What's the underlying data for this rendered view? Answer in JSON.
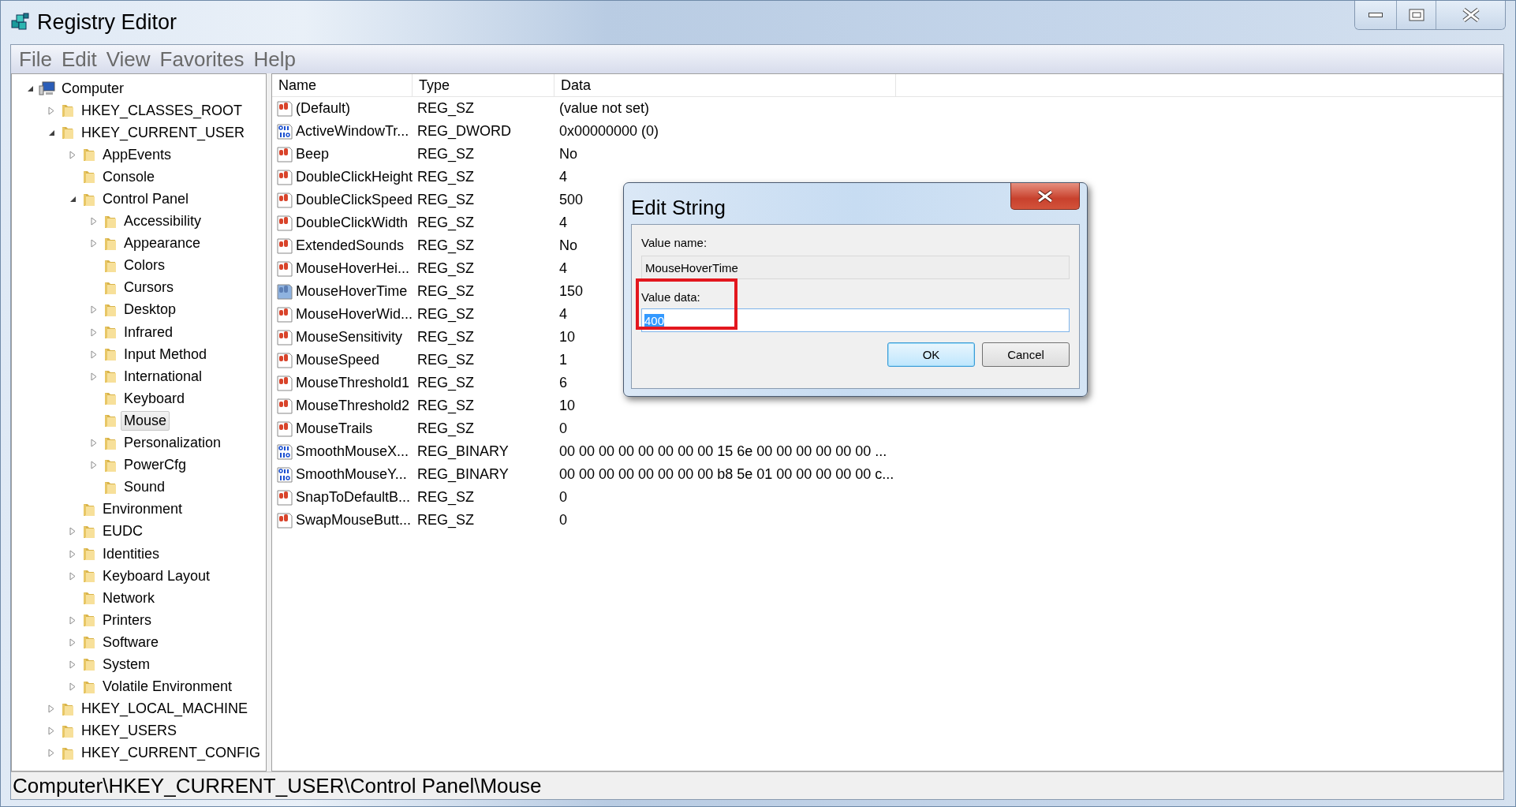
{
  "window": {
    "title": "Registry Editor"
  },
  "menu": [
    "File",
    "Edit",
    "View",
    "Favorites",
    "Help"
  ],
  "tree": [
    {
      "label": "Computer",
      "expandable": true,
      "expanded": true,
      "selected": false,
      "kind": "computer",
      "children": [
        {
          "label": "HKEY_CLASSES_ROOT",
          "expandable": true,
          "expanded": false,
          "selected": false,
          "kind": "folder"
        },
        {
          "label": "HKEY_CURRENT_USER",
          "expandable": true,
          "expanded": true,
          "selected": false,
          "kind": "folder",
          "children": [
            {
              "label": "AppEvents",
              "expandable": true,
              "expanded": false,
              "selected": false,
              "kind": "folder"
            },
            {
              "label": "Console",
              "expandable": false,
              "expanded": false,
              "selected": false,
              "kind": "folder"
            },
            {
              "label": "Control Panel",
              "expandable": true,
              "expanded": true,
              "selected": false,
              "kind": "folder",
              "children": [
                {
                  "label": "Accessibility",
                  "expandable": true,
                  "expanded": false,
                  "selected": false,
                  "kind": "folder"
                },
                {
                  "label": "Appearance",
                  "expandable": true,
                  "expanded": false,
                  "selected": false,
                  "kind": "folder"
                },
                {
                  "label": "Colors",
                  "expandable": false,
                  "expanded": false,
                  "selected": false,
                  "kind": "folder"
                },
                {
                  "label": "Cursors",
                  "expandable": false,
                  "expanded": false,
                  "selected": false,
                  "kind": "folder"
                },
                {
                  "label": "Desktop",
                  "expandable": true,
                  "expanded": false,
                  "selected": false,
                  "kind": "folder"
                },
                {
                  "label": "Infrared",
                  "expandable": true,
                  "expanded": false,
                  "selected": false,
                  "kind": "folder"
                },
                {
                  "label": "Input Method",
                  "expandable": true,
                  "expanded": false,
                  "selected": false,
                  "kind": "folder"
                },
                {
                  "label": "International",
                  "expandable": true,
                  "expanded": false,
                  "selected": false,
                  "kind": "folder"
                },
                {
                  "label": "Keyboard",
                  "expandable": false,
                  "expanded": false,
                  "selected": false,
                  "kind": "folder"
                },
                {
                  "label": "Mouse",
                  "expandable": false,
                  "expanded": false,
                  "selected": true,
                  "kind": "folder"
                },
                {
                  "label": "Personalization",
                  "expandable": true,
                  "expanded": false,
                  "selected": false,
                  "kind": "folder"
                },
                {
                  "label": "PowerCfg",
                  "expandable": true,
                  "expanded": false,
                  "selected": false,
                  "kind": "folder"
                },
                {
                  "label": "Sound",
                  "expandable": false,
                  "expanded": false,
                  "selected": false,
                  "kind": "folder"
                }
              ]
            },
            {
              "label": "Environment",
              "expandable": false,
              "expanded": false,
              "selected": false,
              "kind": "folder"
            },
            {
              "label": "EUDC",
              "expandable": true,
              "expanded": false,
              "selected": false,
              "kind": "folder"
            },
            {
              "label": "Identities",
              "expandable": true,
              "expanded": false,
              "selected": false,
              "kind": "folder"
            },
            {
              "label": "Keyboard Layout",
              "expandable": true,
              "expanded": false,
              "selected": false,
              "kind": "folder"
            },
            {
              "label": "Network",
              "expandable": false,
              "expanded": false,
              "selected": false,
              "kind": "folder"
            },
            {
              "label": "Printers",
              "expandable": true,
              "expanded": false,
              "selected": false,
              "kind": "folder"
            },
            {
              "label": "Software",
              "expandable": true,
              "expanded": false,
              "selected": false,
              "kind": "folder"
            },
            {
              "label": "System",
              "expandable": true,
              "expanded": false,
              "selected": false,
              "kind": "folder"
            },
            {
              "label": "Volatile Environment",
              "expandable": true,
              "expanded": false,
              "selected": false,
              "kind": "folder"
            }
          ]
        },
        {
          "label": "HKEY_LOCAL_MACHINE",
          "expandable": true,
          "expanded": false,
          "selected": false,
          "kind": "folder"
        },
        {
          "label": "HKEY_USERS",
          "expandable": true,
          "expanded": false,
          "selected": false,
          "kind": "folder"
        },
        {
          "label": "HKEY_CURRENT_CONFIG",
          "expandable": true,
          "expanded": false,
          "selected": false,
          "kind": "folder"
        }
      ]
    }
  ],
  "table": {
    "columns": [
      "Name",
      "Type",
      "Data"
    ],
    "rows": [
      {
        "name": "(Default)",
        "type": "REG_SZ",
        "data": "(value not set)",
        "kind": "string",
        "selected": false
      },
      {
        "name": "ActiveWindowTr...",
        "type": "REG_DWORD",
        "data": "0x00000000 (0)",
        "kind": "binary",
        "selected": false
      },
      {
        "name": "Beep",
        "type": "REG_SZ",
        "data": "No",
        "kind": "string",
        "selected": false
      },
      {
        "name": "DoubleClickHeight",
        "type": "REG_SZ",
        "data": "4",
        "kind": "string",
        "selected": false
      },
      {
        "name": "DoubleClickSpeed",
        "type": "REG_SZ",
        "data": "500",
        "kind": "string",
        "selected": false
      },
      {
        "name": "DoubleClickWidth",
        "type": "REG_SZ",
        "data": "4",
        "kind": "string",
        "selected": false
      },
      {
        "name": "ExtendedSounds",
        "type": "REG_SZ",
        "data": "No",
        "kind": "string",
        "selected": false
      },
      {
        "name": "MouseHoverHei...",
        "type": "REG_SZ",
        "data": "4",
        "kind": "string",
        "selected": false
      },
      {
        "name": "MouseHoverTime",
        "type": "REG_SZ",
        "data": "150",
        "kind": "string",
        "selected": true
      },
      {
        "name": "MouseHoverWid...",
        "type": "REG_SZ",
        "data": "4",
        "kind": "string",
        "selected": false
      },
      {
        "name": "MouseSensitivity",
        "type": "REG_SZ",
        "data": "10",
        "kind": "string",
        "selected": false
      },
      {
        "name": "MouseSpeed",
        "type": "REG_SZ",
        "data": "1",
        "kind": "string",
        "selected": false
      },
      {
        "name": "MouseThreshold1",
        "type": "REG_SZ",
        "data": "6",
        "kind": "string",
        "selected": false
      },
      {
        "name": "MouseThreshold2",
        "type": "REG_SZ",
        "data": "10",
        "kind": "string",
        "selected": false
      },
      {
        "name": "MouseTrails",
        "type": "REG_SZ",
        "data": "0",
        "kind": "string",
        "selected": false
      },
      {
        "name": "SmoothMouseX...",
        "type": "REG_BINARY",
        "data": "00 00 00 00 00 00 00 00 15 6e 00 00 00 00 00 00 ...",
        "kind": "binary",
        "selected": false
      },
      {
        "name": "SmoothMouseY...",
        "type": "REG_BINARY",
        "data": "00 00 00 00 00 00 00 00 b8 5e 01 00 00 00 00 00 c...",
        "kind": "binary",
        "selected": false
      },
      {
        "name": "SnapToDefaultB...",
        "type": "REG_SZ",
        "data": "0",
        "kind": "string",
        "selected": false
      },
      {
        "name": "SwapMouseButt...",
        "type": "REG_SZ",
        "data": "0",
        "kind": "string",
        "selected": false
      }
    ]
  },
  "status_bar": "Computer\\HKEY_CURRENT_USER\\Control Panel\\Mouse",
  "dialog": {
    "title": "Edit String",
    "value_name_label": "Value name:",
    "value_name": "MouseHoverTime",
    "value_data_label": "Value data:",
    "value_data": "400",
    "value_data_highlighted": true,
    "buttons": [
      {
        "label": "OK",
        "default": true
      },
      {
        "label": "Cancel",
        "default": false
      }
    ]
  }
}
